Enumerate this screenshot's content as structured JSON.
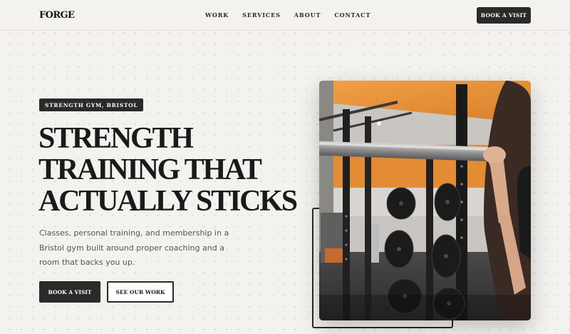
{
  "header": {
    "logo": "FORGE",
    "nav": [
      "WORK",
      "SERVICES",
      "ABOUT",
      "CONTACT"
    ],
    "cta_label": "BOOK A VISIT"
  },
  "hero": {
    "badge": "STRENGTH GYM, BRISTOL",
    "title_lines": [
      "STRENGTH",
      "TRAINING THAT",
      "ACTUALLY STICKS"
    ],
    "description": "Classes, personal training, and membership in a Bristol gym built around proper coaching and a room that backs you up.",
    "primary_cta": "BOOK A VISIT",
    "secondary_cta": "SEE OUR WORK"
  },
  "colors": {
    "background": "#f4f2ef",
    "dark": "#2a2a2a",
    "accent_orange": "#e8953a"
  }
}
